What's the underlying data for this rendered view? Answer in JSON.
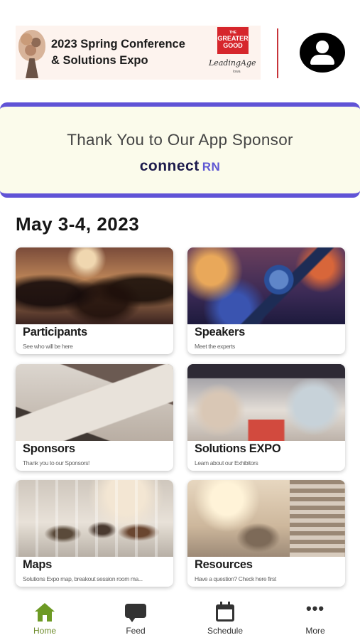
{
  "header": {
    "banner_title_line1": "2023 Spring Conference",
    "banner_title_line2": "& Solutions Expo",
    "logo_greater_good_small": "THE",
    "logo_greater_good_line1": "GREATER",
    "logo_greater_good_line2": "GOOD",
    "logo_leadingage": "LeadingAge",
    "logo_leadingage_sub": "Iowa"
  },
  "sponsor": {
    "text": "Thank You to Our App Sponsor",
    "logo_main": "connect",
    "logo_suffix": "RN"
  },
  "date": "May 3-4, 2023",
  "tiles": [
    {
      "title": "Participants",
      "subtitle": "See who will be here"
    },
    {
      "title": "Speakers",
      "subtitle": "Meet the experts"
    },
    {
      "title": "Sponsors",
      "subtitle": "Thank you to our Sponsors!"
    },
    {
      "title": "Solutions EXPO",
      "subtitle": "Learn about our Exhibitors"
    },
    {
      "title": "Maps",
      "subtitle": "Solutions Expo map, breakout session room ma..."
    },
    {
      "title": "Resources",
      "subtitle": "Have a question? Check here first"
    }
  ],
  "tabbar": {
    "items": [
      {
        "label": "Home",
        "icon": "home-icon",
        "active": true
      },
      {
        "label": "Feed",
        "icon": "chat-bubble-icon"
      },
      {
        "label": "Schedule",
        "icon": "calendar-icon"
      },
      {
        "label": "More",
        "icon": "more-dots-icon"
      }
    ],
    "more_glyph": "•••"
  },
  "colors": {
    "accent_purple": "#6053d6",
    "active_green": "#6d9a24",
    "header_red": "#c7343a"
  }
}
